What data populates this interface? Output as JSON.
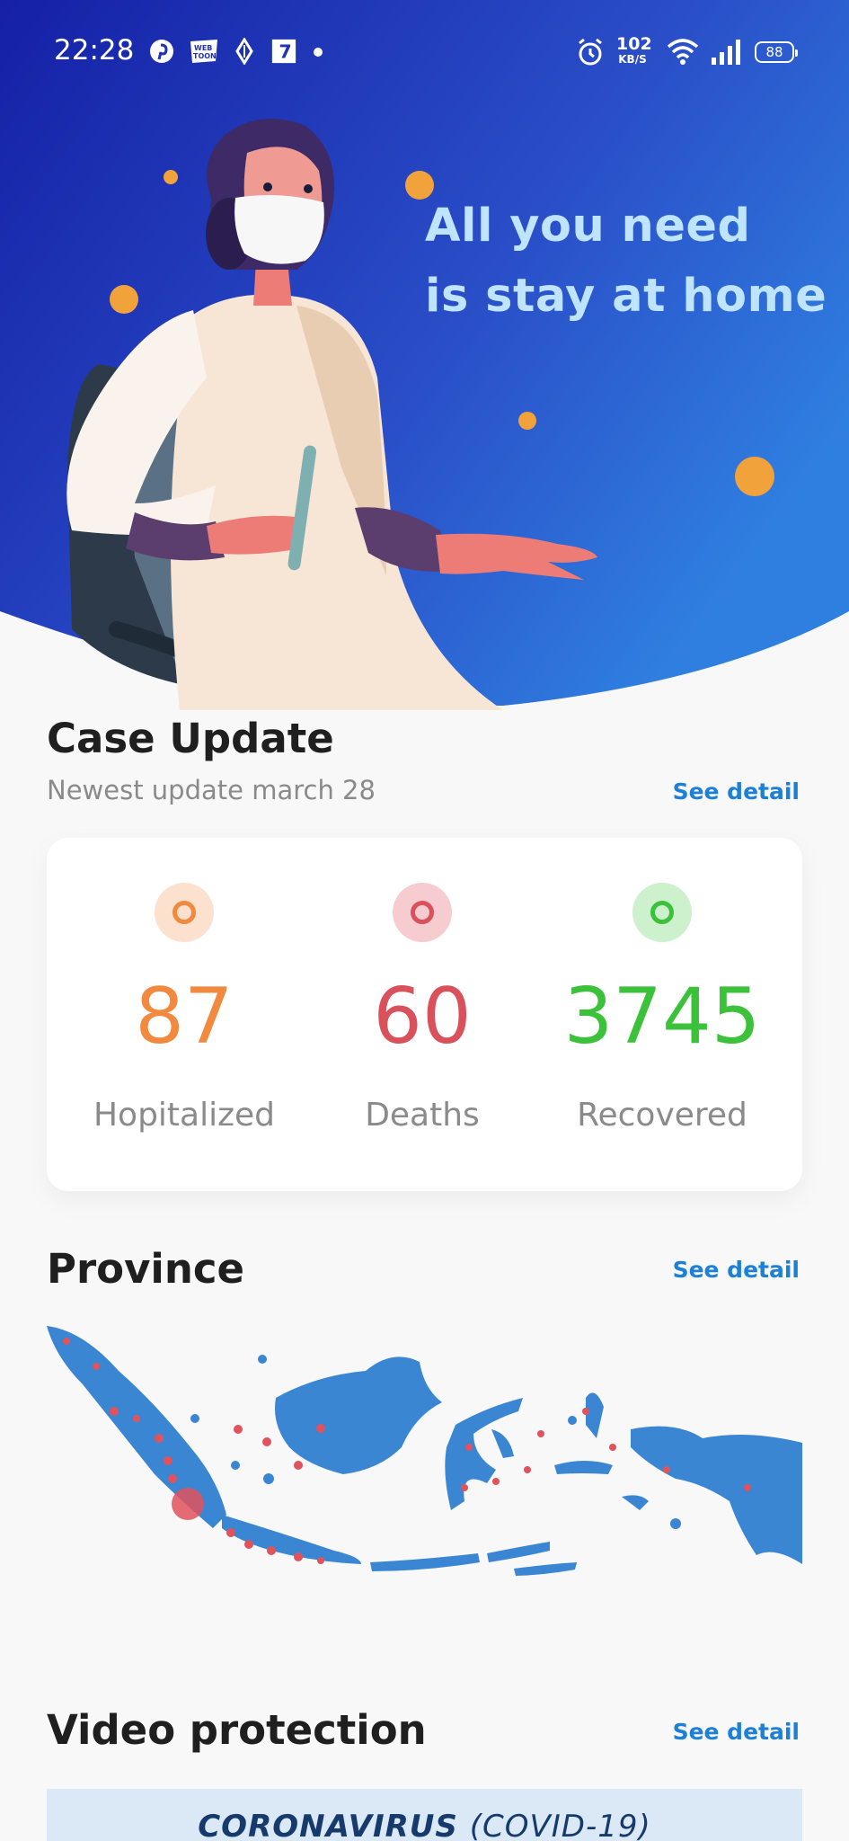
{
  "status_bar": {
    "time": "22:28",
    "app_icons": [
      "pinterest-icon",
      "webtoon-icon",
      "ingress-icon",
      "seven-eleven-icon",
      "dot-icon"
    ],
    "network_speed": "102",
    "network_speed_unit": "KB/S",
    "battery": "88"
  },
  "hero": {
    "line1": "All you need",
    "line2": "is stay at home"
  },
  "case_update": {
    "title": "Case Update",
    "subtitle": "Newest update march 28",
    "see_detail": "See detail",
    "stats": [
      {
        "value": "87",
        "label": "Hopitalized",
        "color": "#f18a3e",
        "bg": "#fde1cf"
      },
      {
        "value": "60",
        "label": "Deaths",
        "color": "#d9515a",
        "bg": "#f7ccd0"
      },
      {
        "value": "3745",
        "label": "Recovered",
        "color": "#3cc13b",
        "bg": "#cdf0cd"
      }
    ]
  },
  "province": {
    "title": "Province",
    "see_detail": "See detail"
  },
  "video": {
    "title": "Video protection",
    "see_detail": "See detail",
    "banner_bold": "CORONAVIRUS",
    "banner_light": "(COVID-19)"
  },
  "colors": {
    "header_dark": "#1520a6",
    "header_light": "#2f7fe0",
    "accent": "#1d7fd6",
    "map_fill": "#3a86d3"
  }
}
